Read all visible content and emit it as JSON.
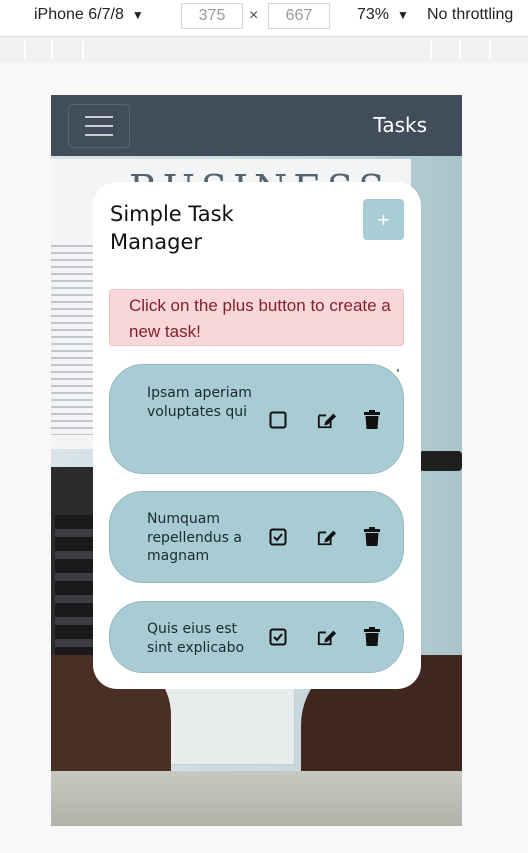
{
  "devtools": {
    "device_name": "iPhone 6/7/8",
    "width_value": "375",
    "height_value": "667",
    "dimension_separator": "×",
    "zoom": "73%",
    "throttling": "No throttling"
  },
  "app": {
    "nav_title": "Tasks",
    "card_title": "Simple Task Manager",
    "add_button_label": "+",
    "alert_text": "Click on the plus button to create a new task!",
    "tasks": [
      {
        "text": "Ipsam aperiam voluptates qui",
        "completed": false
      },
      {
        "text": "Numquam repellendus a magnam",
        "completed": true
      },
      {
        "text": "Quis eius est sint explicabo",
        "completed": true
      }
    ]
  },
  "background_headline": "BUSINESS",
  "colors": {
    "navbar": "#414d5a",
    "task_bg": "#a9cbd3",
    "add_button": "#a9cdd5",
    "alert_bg": "#f8d7da",
    "alert_text": "#842029"
  },
  "icons": {
    "menu": "hamburger-icon",
    "checkbox_empty": "square-icon",
    "checkbox_checked": "check-square-icon",
    "edit": "edit-icon",
    "delete": "trash-icon"
  }
}
